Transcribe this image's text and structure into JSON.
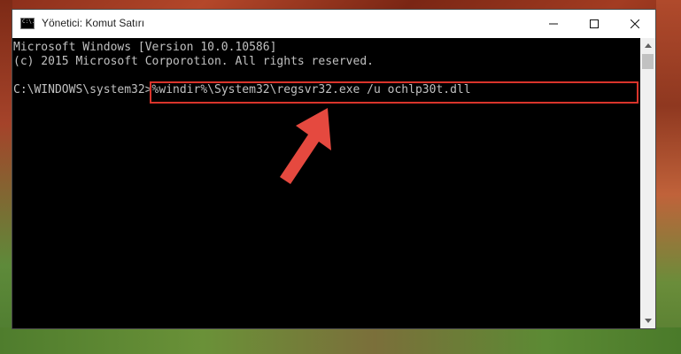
{
  "window": {
    "title": "Yönetici: Komut Satırı",
    "icon_text": "C:\\."
  },
  "console": {
    "lines": [
      "Microsoft Windows [Version 10.0.10586]",
      "(c) 2015 Microsoft Corporotion. All rights reserved."
    ],
    "prompt": "C:\\WINDOWS\\system32>",
    "command": "%windir%\\System32\\regsvr32.exe /u ochlp30t.dll"
  },
  "colors": {
    "highlight": "#d9342b",
    "arrow": "#e5493f",
    "console_text": "#c0c0c0",
    "console_bg": "#000000"
  },
  "icons": {
    "minimize": "minimize-icon",
    "maximize": "maximize-icon",
    "close": "close-icon",
    "scroll_up": "chevron-up-icon",
    "scroll_down": "chevron-down-icon",
    "annotation": "arrow-icon"
  }
}
